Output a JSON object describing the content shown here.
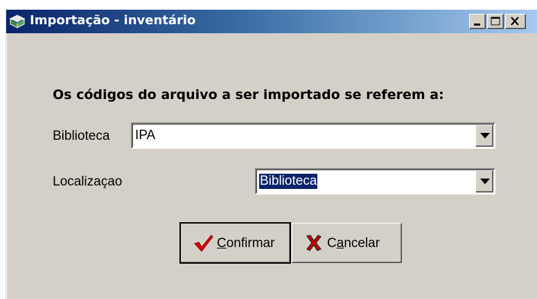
{
  "window": {
    "title": "Importação - inventário",
    "icon": "book-icon"
  },
  "titlebar_buttons": {
    "minimize": "minimize-icon",
    "maximize": "maximize-icon",
    "close": "close-icon"
  },
  "form": {
    "heading": "Os códigos do arquivo a ser importado se referem a:",
    "biblioteca": {
      "label": "Biblioteca",
      "value": "IPA"
    },
    "localizacao": {
      "label": "Localizaçao",
      "value": "Biblioteca"
    }
  },
  "buttons": {
    "confirm": {
      "mnemonic": "C",
      "rest": "onfirmar",
      "icon": "checkmark-icon",
      "icon_color": "#e00000"
    },
    "cancel": {
      "pre": "C",
      "mnemonic": "a",
      "rest": "ncelar",
      "icon": "x-mark-icon",
      "icon_color": "#cc0000"
    }
  },
  "colors": {
    "titlebar_start": "#0a246a",
    "titlebar_end": "#a6caf0",
    "face": "#d4d0c8",
    "selection": "#0a246a"
  }
}
